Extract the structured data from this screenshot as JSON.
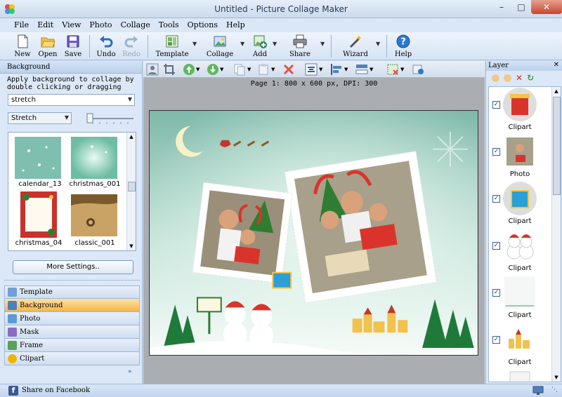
{
  "window": {
    "title": "Untitled - Picture Collage Maker"
  },
  "menu": [
    "File",
    "Edit",
    "View",
    "Photo",
    "Collage",
    "Tools",
    "Options",
    "Help"
  ],
  "toolbar": {
    "new": "New",
    "open": "Open",
    "save": "Save",
    "undo": "Undo",
    "redo": "Redo",
    "template": "Template",
    "collage": "Collage",
    "add": "Add",
    "share": "Share",
    "wizard": "Wizard",
    "help": "Help"
  },
  "left": {
    "header": "Background",
    "description": "Apply background to collage by double clicking or dragging",
    "category_select": "stretch",
    "fit_select": "Stretch",
    "thumbnails": [
      "calendar_13",
      "christmas_001",
      "christmas_04",
      "classic_001"
    ],
    "more_button": "More Settings..",
    "nav": [
      "Template",
      "Background",
      "Photo",
      "Mask",
      "Frame",
      "Clipart"
    ],
    "active_nav": "Background"
  },
  "main": {
    "page_info": "Page 1: 800 x 600 px, DPI: 300"
  },
  "layers": {
    "header": "Layer",
    "items": [
      "Clipart",
      "Photo",
      "Clipart",
      "Clipart",
      "Clipart",
      "Clipart"
    ]
  },
  "status": {
    "share": "Share on Facebook"
  }
}
